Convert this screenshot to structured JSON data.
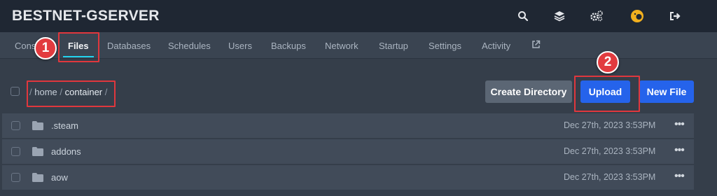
{
  "app": {
    "server_name": "BESTNET-GSERVER"
  },
  "top_icons": [
    "search-icon",
    "layers-icon",
    "settings-icon",
    "avatar",
    "logout-icon"
  ],
  "tabs": [
    {
      "label": "Cons",
      "active": false
    },
    {
      "label": "Files",
      "active": true
    },
    {
      "label": "Databases",
      "active": false
    },
    {
      "label": "Schedules",
      "active": false
    },
    {
      "label": "Users",
      "active": false
    },
    {
      "label": "Backups",
      "active": false
    },
    {
      "label": "Network",
      "active": false
    },
    {
      "label": "Startup",
      "active": false
    },
    {
      "label": "Settings",
      "active": false
    },
    {
      "label": "Activity",
      "active": false
    }
  ],
  "breadcrumb": {
    "separator": "/",
    "segments": [
      "home",
      "container"
    ]
  },
  "actions": {
    "create_directory": "Create Directory",
    "upload": "Upload",
    "new_file": "New File"
  },
  "files": [
    {
      "name": ".steam",
      "modified": "Dec 27th, 2023 3:53PM"
    },
    {
      "name": "addons",
      "modified": "Dec 27th, 2023 3:53PM"
    },
    {
      "name": "aow",
      "modified": "Dec 27th, 2023 3:53PM"
    }
  ],
  "annotations": {
    "marker_1": "1",
    "marker_2": "2"
  },
  "colors": {
    "callout": "#e0373d",
    "primary_button": "#2563eb",
    "secondary_button": "#5b6674",
    "active_tab_underline": "#22d3ee"
  }
}
